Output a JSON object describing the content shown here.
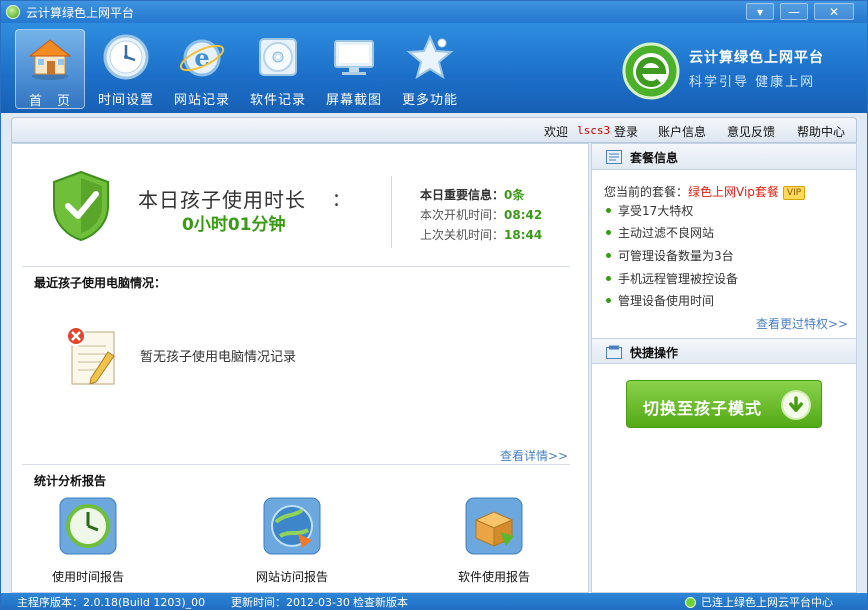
{
  "window": {
    "title": "云计算绿色上网平台",
    "controls": {
      "menu": "▾",
      "minimize": "—",
      "close": "✕"
    }
  },
  "nav": [
    {
      "label": "首　页",
      "icon": "home-icon",
      "active": true
    },
    {
      "label": "时间设置",
      "icon": "clock-icon",
      "active": false
    },
    {
      "label": "网站记录",
      "icon": "ie-browser-icon",
      "active": false
    },
    {
      "label": "软件记录",
      "icon": "cd-disc-icon",
      "active": false
    },
    {
      "label": "屏幕截图",
      "icon": "monitor-icon",
      "active": false
    },
    {
      "label": "更多功能",
      "icon": "star-icon",
      "active": false
    }
  ],
  "brand": {
    "name": "云计算绿色上网平台",
    "slogan": "科学引导 健康上网",
    "logo_icon": "green-e-logo-icon"
  },
  "topbar": {
    "welcome": "欢迎",
    "username": "lscs3",
    "login": "登录",
    "account": "账户信息",
    "feedback": "意见反馈",
    "help": "帮助中心"
  },
  "today": {
    "label": "本日孩子使用时长",
    "colon": "：",
    "value": "0小时01分钟",
    "important_label": "本日重要信息：",
    "important_value": "0条",
    "boot_label": "本次开机时间：",
    "boot_value": "08:42",
    "shutdown_label": "上次关机时间：",
    "shutdown_value": "18:44"
  },
  "recent": {
    "title": "最近孩子使用电脑情况：",
    "empty": "暂无孩子使用电脑情况记录",
    "more": "查看详情>>"
  },
  "reports": {
    "title": "统计分析报告",
    "items": [
      {
        "label": "使用时间报告",
        "icon": "time-report-icon"
      },
      {
        "label": "网站访问报告",
        "icon": "website-report-icon"
      },
      {
        "label": "软件使用报告",
        "icon": "software-report-icon"
      }
    ]
  },
  "plan": {
    "title": "套餐信息",
    "current_label": "您当前的套餐：",
    "current_value": "绿色上网Vip套餐",
    "badge": "VIP",
    "privileges": [
      "享受17大特权",
      "主动过滤不良网站",
      "可管理设备数量为3台",
      "手机远程管理被控设备",
      "管理设备使用时间"
    ],
    "more": "查看更过特权>>"
  },
  "quick": {
    "title": "快捷操作",
    "switch_label": "切换至孩子模式"
  },
  "status": {
    "version": "主程序版本：2.0.18(Build 1203)_00",
    "update_time": "更新时间：2012-03-30",
    "check": "检查新版本",
    "connected": "已连上绿色上网云平台中心"
  },
  "colors": {
    "accent_blue": "#1f6fc3",
    "green": "#3a9a15",
    "link": "#4a80c0",
    "red": "#d21"
  }
}
